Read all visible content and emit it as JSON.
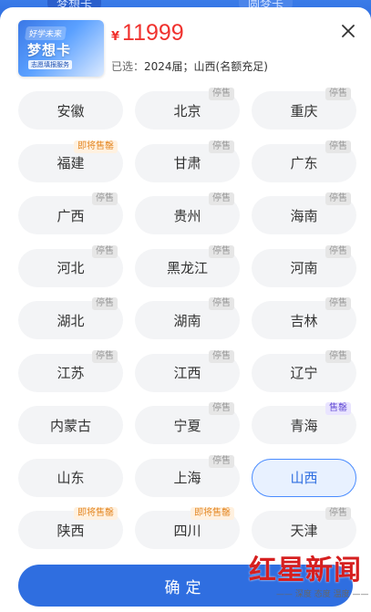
{
  "background": {
    "tab_left_label": "梦想卡",
    "tab_right_label": "圆梦卡"
  },
  "product": {
    "thumb_badge": "好学未来",
    "thumb_title": "梦想卡",
    "thumb_subtitle": "志愿填报服务",
    "currency": "¥",
    "price": "11999",
    "selected_label": "已选：",
    "selected_value": "2024届；山西(名额充足)"
  },
  "provinces": [
    {
      "name": "安徽",
      "tag": null,
      "tag_type": null
    },
    {
      "name": "北京",
      "tag": "停售",
      "tag_type": "stop"
    },
    {
      "name": "重庆",
      "tag": "停售",
      "tag_type": "stop"
    },
    {
      "name": "福建",
      "tag": "即将售罄",
      "tag_type": "soon"
    },
    {
      "name": "甘肃",
      "tag": "停售",
      "tag_type": "stop"
    },
    {
      "name": "广东",
      "tag": "停售",
      "tag_type": "stop"
    },
    {
      "name": "广西",
      "tag": "停售",
      "tag_type": "stop"
    },
    {
      "name": "贵州",
      "tag": "停售",
      "tag_type": "stop"
    },
    {
      "name": "海南",
      "tag": "停售",
      "tag_type": "stop"
    },
    {
      "name": "河北",
      "tag": "停售",
      "tag_type": "stop"
    },
    {
      "name": "黑龙江",
      "tag": "停售",
      "tag_type": "stop"
    },
    {
      "name": "河南",
      "tag": "停售",
      "tag_type": "stop"
    },
    {
      "name": "湖北",
      "tag": "停售",
      "tag_type": "stop"
    },
    {
      "name": "湖南",
      "tag": "停售",
      "tag_type": "stop"
    },
    {
      "name": "吉林",
      "tag": "停售",
      "tag_type": "stop"
    },
    {
      "name": "江苏",
      "tag": "停售",
      "tag_type": "stop"
    },
    {
      "name": "江西",
      "tag": "停售",
      "tag_type": "stop"
    },
    {
      "name": "辽宁",
      "tag": "停售",
      "tag_type": "stop"
    },
    {
      "name": "内蒙古",
      "tag": null,
      "tag_type": null
    },
    {
      "name": "宁夏",
      "tag": "停售",
      "tag_type": "stop"
    },
    {
      "name": "青海",
      "tag": "售罄",
      "tag_type": "sold"
    },
    {
      "name": "山东",
      "tag": null,
      "tag_type": null
    },
    {
      "name": "上海",
      "tag": "停售",
      "tag_type": "stop"
    },
    {
      "name": "山西",
      "tag": null,
      "tag_type": null,
      "selected": true
    },
    {
      "name": "陕西",
      "tag": "即将售罄",
      "tag_type": "soon"
    },
    {
      "name": "四川",
      "tag": "即将售罄",
      "tag_type": "soon"
    },
    {
      "name": "天津",
      "tag": "停售",
      "tag_type": "stop"
    }
  ],
  "footer": {
    "confirm_label": "确定"
  },
  "watermark": {
    "main": "红星新闻",
    "sub": "—— 深度 态度 温度 ——"
  },
  "colors": {
    "accent": "#2f6ee0",
    "price": "#f0322e",
    "selected_border": "#4a8cff",
    "chip_bg": "#f3f4f6"
  }
}
